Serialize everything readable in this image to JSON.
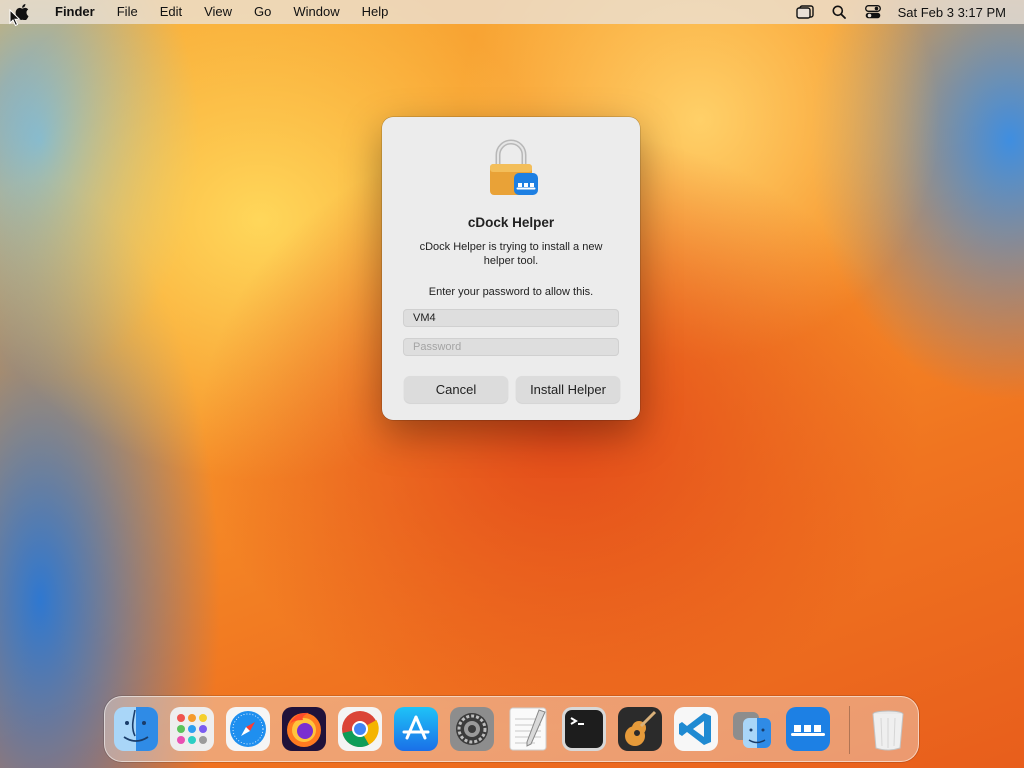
{
  "menubar": {
    "app_name": "Finder",
    "items": [
      "File",
      "Edit",
      "View",
      "Go",
      "Window",
      "Help"
    ],
    "clock": "Sat Feb 3  3:17 PM"
  },
  "dialog": {
    "title": "cDock Helper",
    "message": "cDock Helper is trying to install a new helper tool.",
    "prompt": "Enter your password to allow this.",
    "username_value": "VM4",
    "password_placeholder": "Password",
    "cancel_label": "Cancel",
    "confirm_label": "Install Helper"
  },
  "dock": {
    "apps": [
      "finder-icon",
      "launchpad-icon",
      "safari-icon",
      "firefox-icon",
      "chrome-icon",
      "app-store-icon",
      "system-settings-icon",
      "textedit-icon",
      "terminal-icon",
      "garageband-icon",
      "vscode-icon",
      "migration-assistant-icon",
      "cdock-icon",
      "trash-icon"
    ]
  },
  "colors": {
    "wallpaper_orange": "#f7942a",
    "wallpaper_red": "#e34a1a",
    "wallpaper_blue": "#2f78d0",
    "dialog_bg": "#ececec"
  }
}
